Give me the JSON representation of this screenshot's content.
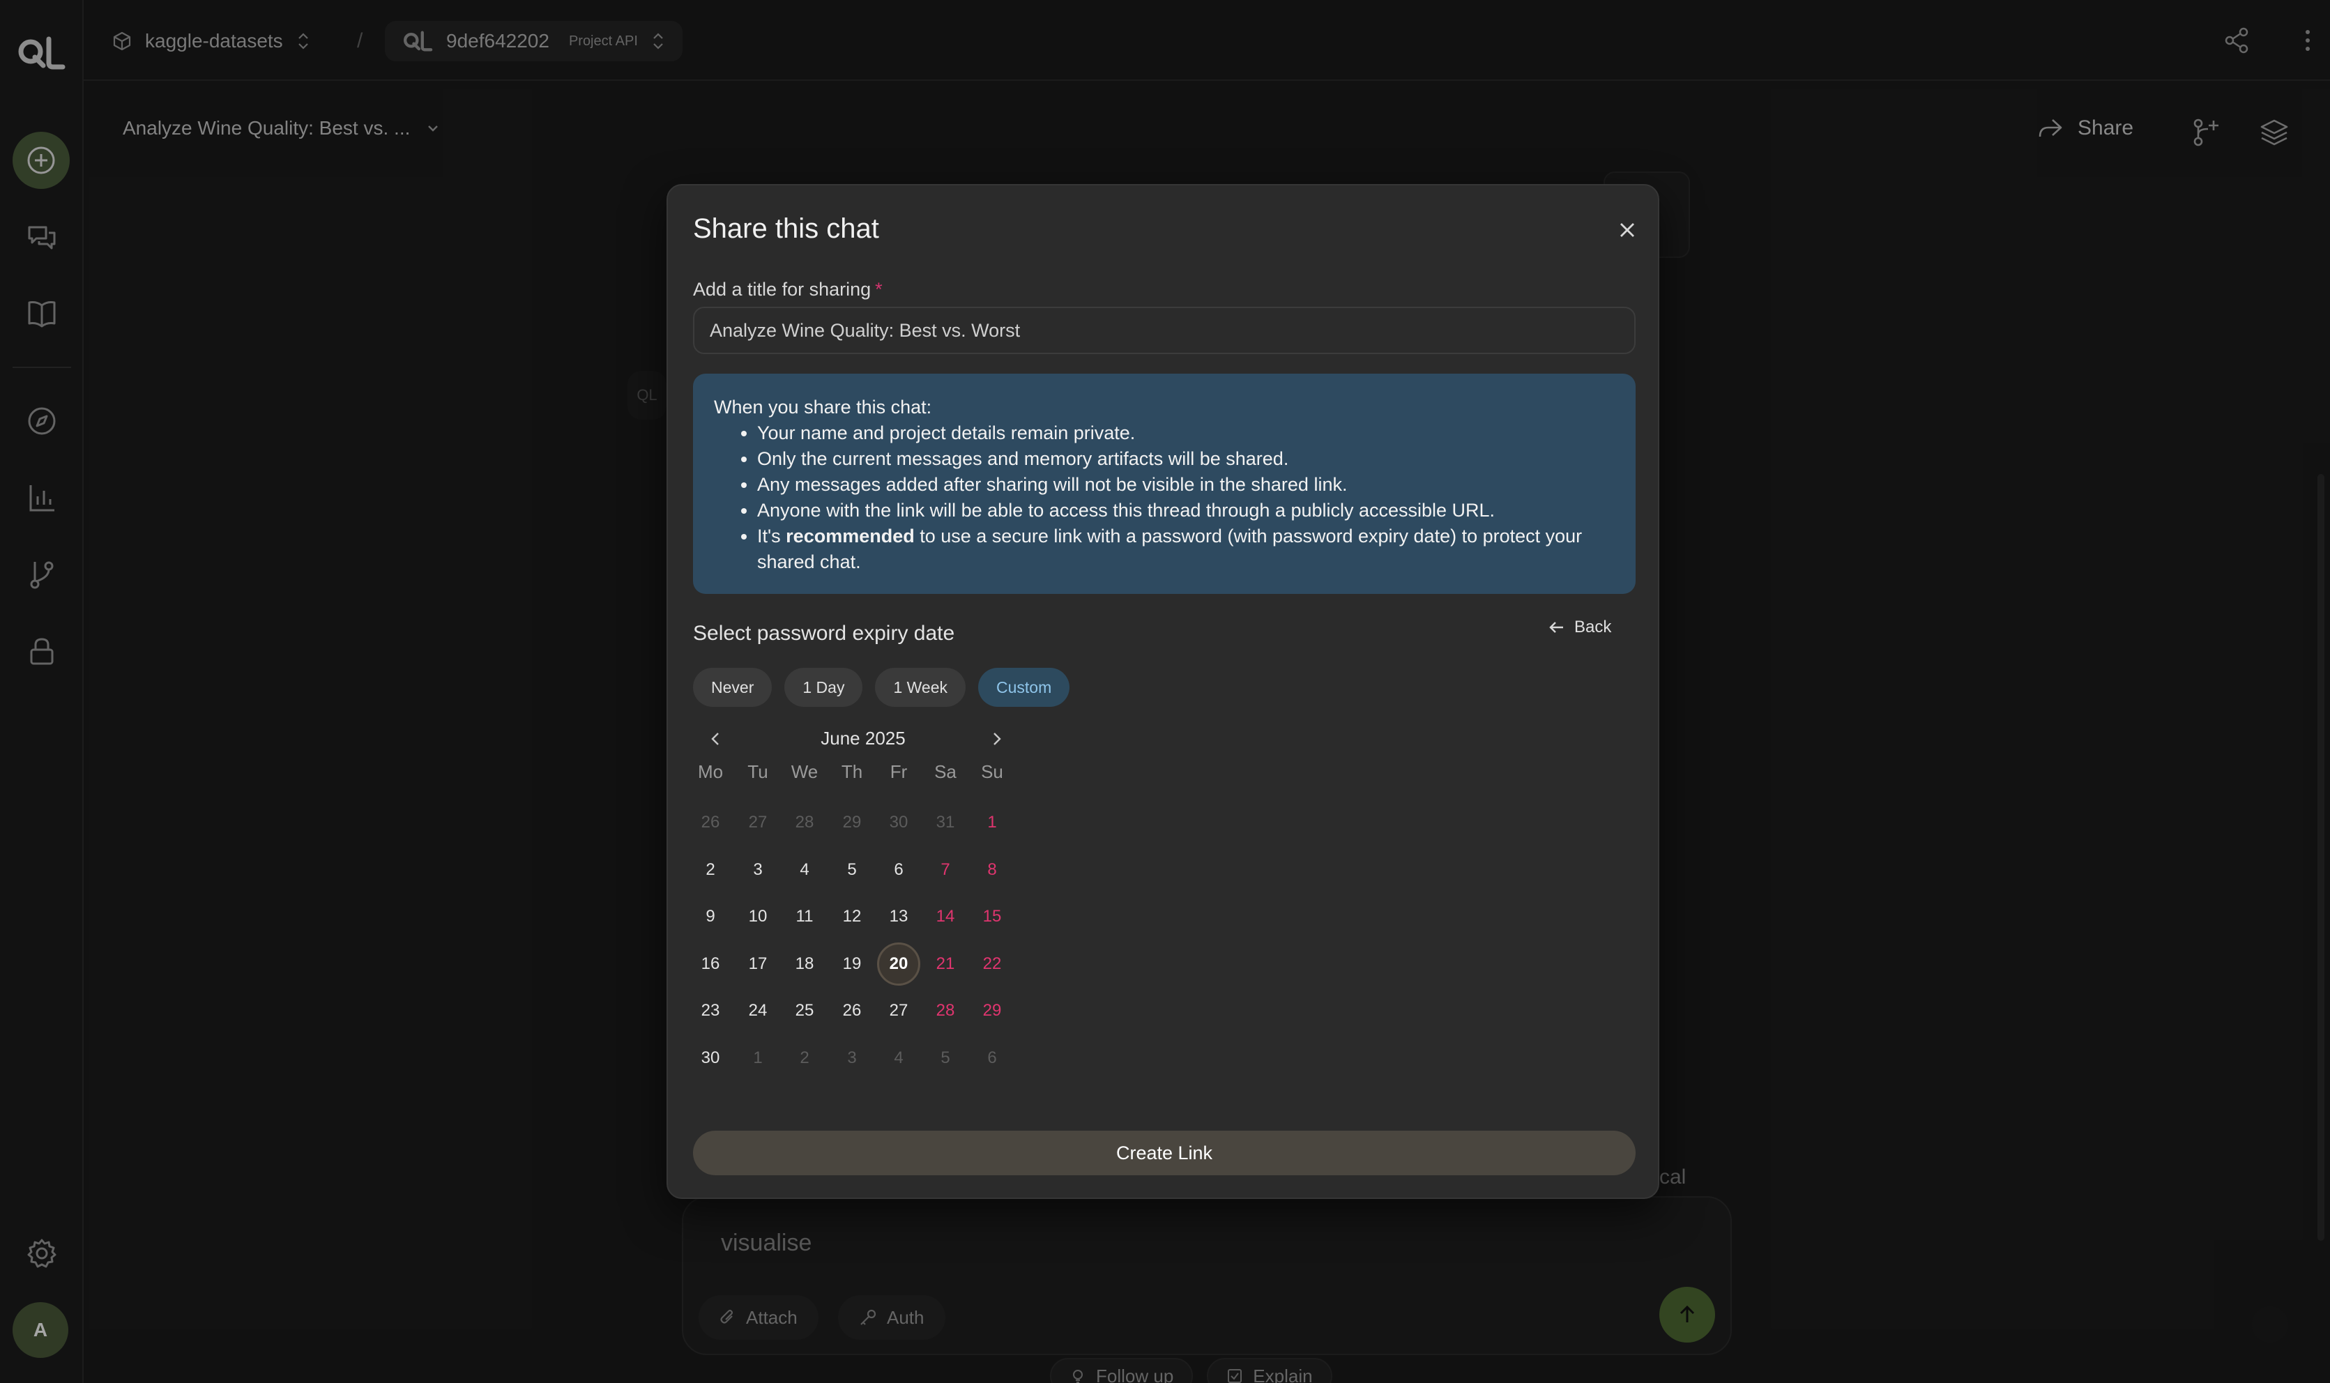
{
  "app": {
    "logo": "QL"
  },
  "topbar": {
    "project": "kaggle-datasets",
    "separator": "/",
    "api_name": "9def642202",
    "api_tag": "Project API"
  },
  "chat": {
    "title": "Analyze Wine Quality: Best vs. ...",
    "share_label": "Share"
  },
  "background": {
    "partial_text": "cal",
    "bot_avatar": "QL"
  },
  "composer": {
    "placeholder": "visualise",
    "attach_label": "Attach",
    "auth_label": "Auth",
    "followups": [
      "Follow up",
      "Explain"
    ]
  },
  "user": {
    "avatar_initial": "A"
  },
  "modal": {
    "title": "Share this chat",
    "field_label": "Add a title for sharing",
    "required_mark": "*",
    "title_value": "Analyze Wine Quality: Best vs. Worst",
    "info_heading": "When you share this chat:",
    "info_items": [
      "Your name and project details remain private.",
      "Only the current messages and memory artifacts will be shared.",
      "Any messages added after sharing will not be visible in the shared link.",
      "Anyone with the link will be able to access this thread through a publicly accessible URL."
    ],
    "info_last_prefix": "It's ",
    "info_last_bold": "recommended",
    "info_last_suffix": " to use a secure link with a password (with password expiry date) to protect your shared chat.",
    "expiry_label": "Select password expiry date",
    "back_label": "Back",
    "presets": [
      "Never",
      "1 Day",
      "1 Week",
      "Custom"
    ],
    "active_preset": "Custom",
    "create_label": "Create Link"
  },
  "calendar": {
    "month_label": "June 2025",
    "weekdays": [
      "Mo",
      "Tu",
      "We",
      "Th",
      "Fr",
      "Sa",
      "Su"
    ],
    "weeks": [
      [
        "26",
        "27",
        "28",
        "29",
        "30",
        "31",
        "1"
      ],
      [
        "2",
        "3",
        "4",
        "5",
        "6",
        "7",
        "8"
      ],
      [
        "9",
        "10",
        "11",
        "12",
        "13",
        "14",
        "15"
      ],
      [
        "16",
        "17",
        "18",
        "19",
        "20",
        "21",
        "22"
      ],
      [
        "23",
        "24",
        "25",
        "26",
        "27",
        "28",
        "29"
      ],
      [
        "30",
        "1",
        "2",
        "3",
        "4",
        "5",
        "6"
      ]
    ],
    "selected": "20",
    "colors": {
      "weekend": "#e0356f",
      "muted": "#5c5c5c",
      "accent": "#2d4a5e"
    }
  }
}
